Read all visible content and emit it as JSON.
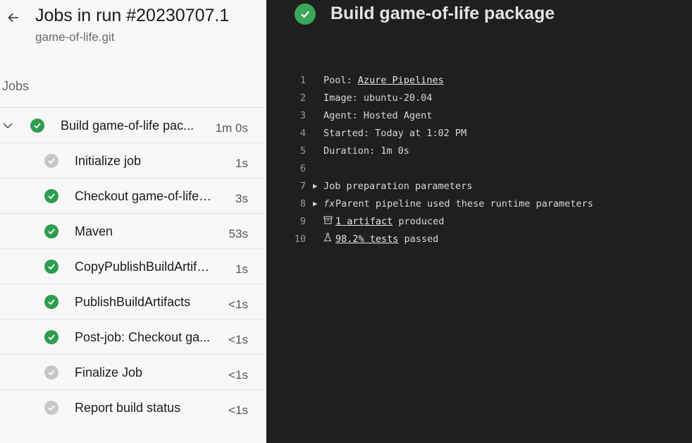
{
  "header": {
    "title": "Jobs in run #20230707.1",
    "subtitle": "game-of-life.git"
  },
  "jobs_section": {
    "label": "Jobs"
  },
  "jobs": {
    "parent": {
      "label": "Build game-of-life pac...",
      "duration": "1m 0s",
      "status": "succeeded"
    },
    "steps": [
      {
        "label": "Initialize job",
        "duration": "1s",
        "status": "skipped"
      },
      {
        "label": "Checkout game-of-life....",
        "duration": "3s",
        "status": "succeeded"
      },
      {
        "label": "Maven",
        "duration": "53s",
        "status": "succeeded"
      },
      {
        "label": "CopyPublishBuildArtifa...",
        "duration": "1s",
        "status": "succeeded"
      },
      {
        "label": "PublishBuildArtifacts",
        "duration": "<1s",
        "status": "succeeded"
      },
      {
        "label": "Post-job: Checkout ga...",
        "duration": "<1s",
        "status": "succeeded"
      },
      {
        "label": "Finalize Job",
        "duration": "<1s",
        "status": "skipped"
      },
      {
        "label": "Report build status",
        "duration": "<1s",
        "status": "skipped"
      }
    ]
  },
  "detail": {
    "title": "Build game-of-life package",
    "log": [
      {
        "num": "1",
        "prefix": "Pool: ",
        "link": "Azure Pipelines",
        "suffix": ""
      },
      {
        "num": "2",
        "text": "Image: ubuntu-20.04"
      },
      {
        "num": "3",
        "text": "Agent: Hosted Agent"
      },
      {
        "num": "4",
        "text": "Started: Today at 1:02 PM"
      },
      {
        "num": "5",
        "text": "Duration: 1m 0s"
      },
      {
        "num": "6",
        "text": ""
      },
      {
        "num": "7",
        "text": "Job preparation parameters"
      },
      {
        "num": "8",
        "icon": "fx",
        "text": "Parent pipeline used these runtime parameters"
      },
      {
        "num": "9",
        "link": "1 artifact",
        "suffix": " produced"
      },
      {
        "num": "10",
        "link": "98.2% tests",
        "suffix": " passed"
      }
    ]
  },
  "colors": {
    "success": "#2e9d4f",
    "skipped": "#c7c7c7",
    "log_background": "#1f1f1f",
    "left_background": "#f8f8f8"
  },
  "icons": {
    "back": "arrow-left-icon",
    "expand": "chevron-down-icon",
    "success": "check-circle-icon",
    "artifact": "archive-icon",
    "tests": "flask-icon",
    "expander": "triangle-right-icon"
  }
}
